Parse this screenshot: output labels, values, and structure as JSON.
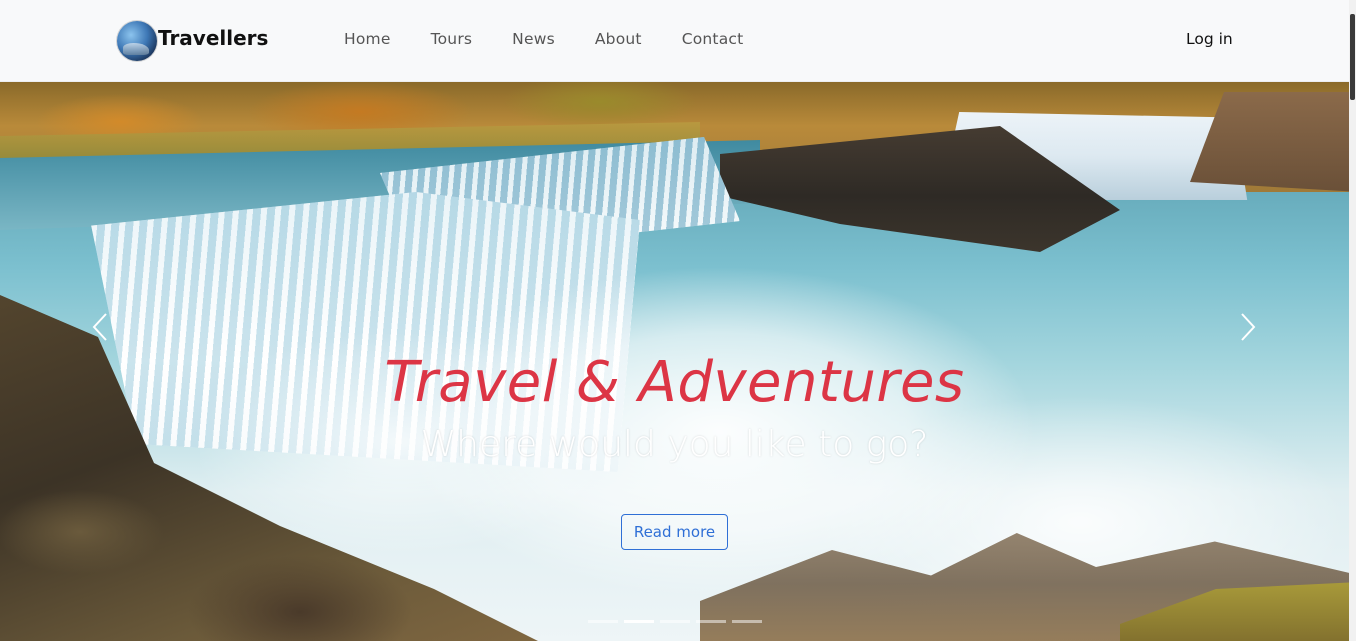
{
  "navbar": {
    "brand": "Travellers",
    "logo_icon": "globe-icon",
    "links": [
      "Home",
      "Tours",
      "News",
      "About",
      "Contact"
    ],
    "login": "Log in"
  },
  "hero": {
    "title": "Travel & Adventures",
    "subtitle": "Where would you like to go?",
    "button": "Read more",
    "prev_icon": "chevron-left-icon",
    "next_icon": "chevron-right-icon",
    "indicator_count": 5,
    "active_indicator": 2,
    "title_color": "#dc3545",
    "button_color": "#2f6fd6"
  }
}
